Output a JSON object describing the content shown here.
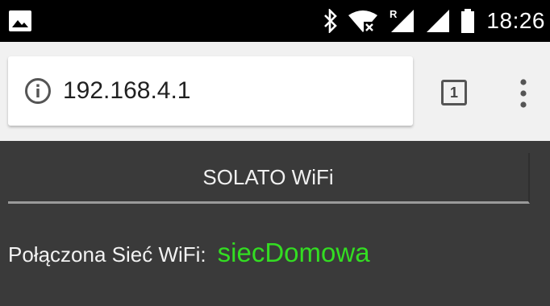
{
  "status_bar": {
    "time": "18:26",
    "icons": [
      "image-icon",
      "bluetooth-icon",
      "wifi-no-internet-icon",
      "roaming-signal-icon",
      "signal-icon",
      "battery-icon"
    ]
  },
  "browser": {
    "url": "192.168.4.1",
    "tab_count": "1",
    "icons": [
      "info-icon",
      "tab-switcher-icon",
      "overflow-menu-icon"
    ]
  },
  "page": {
    "header": "SOLATO WiFi",
    "wifi_label": "Połączona Sieć WiFi:",
    "wifi_value": "siecDomowa"
  },
  "colors": {
    "page_background": "#3a3a3a",
    "network_name": "#33dd22",
    "status_bar": "#000000",
    "toolbar": "#f1f1f1"
  }
}
